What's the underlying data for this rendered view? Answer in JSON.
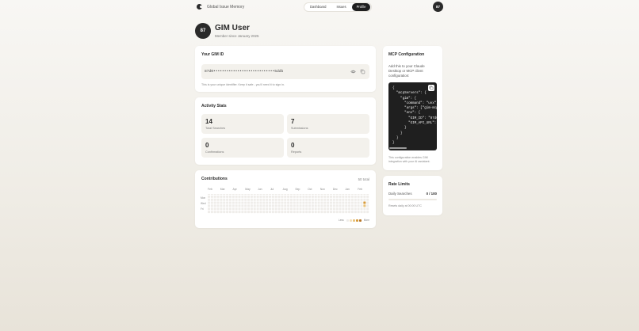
{
  "nav": {
    "brand": "Global Issue Memory",
    "tabs": [
      {
        "label": "Dashboard",
        "active": false
      },
      {
        "label": "Issues",
        "active": false
      },
      {
        "label": "Profile",
        "active": true
      }
    ],
    "avatar_initials": "87"
  },
  "profile": {
    "avatar_initials": "87",
    "name": "GIM User",
    "member_since": "Member since January 2025"
  },
  "gim_id": {
    "title": "Your GIM ID",
    "value": "87d0••••••••••••••••••••••••••••5ddb",
    "hint": "This is your unique identifier. Keep it safe - you'll need it to sign in."
  },
  "activity": {
    "title": "Activity Stats",
    "stats": [
      {
        "value": "14",
        "label": "Total Searches"
      },
      {
        "value": "7",
        "label": "Submissions"
      },
      {
        "value": "0",
        "label": "Confirmations"
      },
      {
        "value": "0",
        "label": "Reports"
      }
    ]
  },
  "contributions": {
    "title": "Contributions",
    "total": "50 total",
    "months": [
      "Feb",
      "Mar",
      "Apr",
      "May",
      "Jun",
      "Jul",
      "Aug",
      "Sep",
      "Oct",
      "Nov",
      "Dec",
      "Jan",
      "Feb"
    ],
    "day_labels": [
      "Mon",
      "Wed",
      "Fri"
    ],
    "weeks": 53,
    "active_cells": [
      {
        "week": 51,
        "day": 3,
        "level": 3
      },
      {
        "week": 51,
        "day": 4,
        "level": 2
      }
    ],
    "legend_less": "Less",
    "legend_more": "More",
    "level_colors": [
      "#efedea",
      "#f4dfb8",
      "#e9c27a",
      "#d69a3a",
      "#b8772a"
    ]
  },
  "mcp": {
    "title": "MCP Configuration",
    "description": "Add this to your Claude Desktop or MCP client configuration:",
    "code": "{\n  \"mcpServers\": {\n    \"gim\": {\n      \"command\": \"uvx\",\n      \"args\": [\"gim-mcp\"],\n      \"env\": {\n        \"GIM_ID\": \"87d0\",\n        \"GIM_API_URL\": \"\"\n      }\n    }\n  }\n}",
    "note": "This configuration enables GIM integration with your AI assistant."
  },
  "rate_limits": {
    "title": "Rate Limits",
    "label": "Daily Searches",
    "value": "0 / 100",
    "used_fraction": 0,
    "reset": "Resets daily at 00:00 UTC"
  }
}
